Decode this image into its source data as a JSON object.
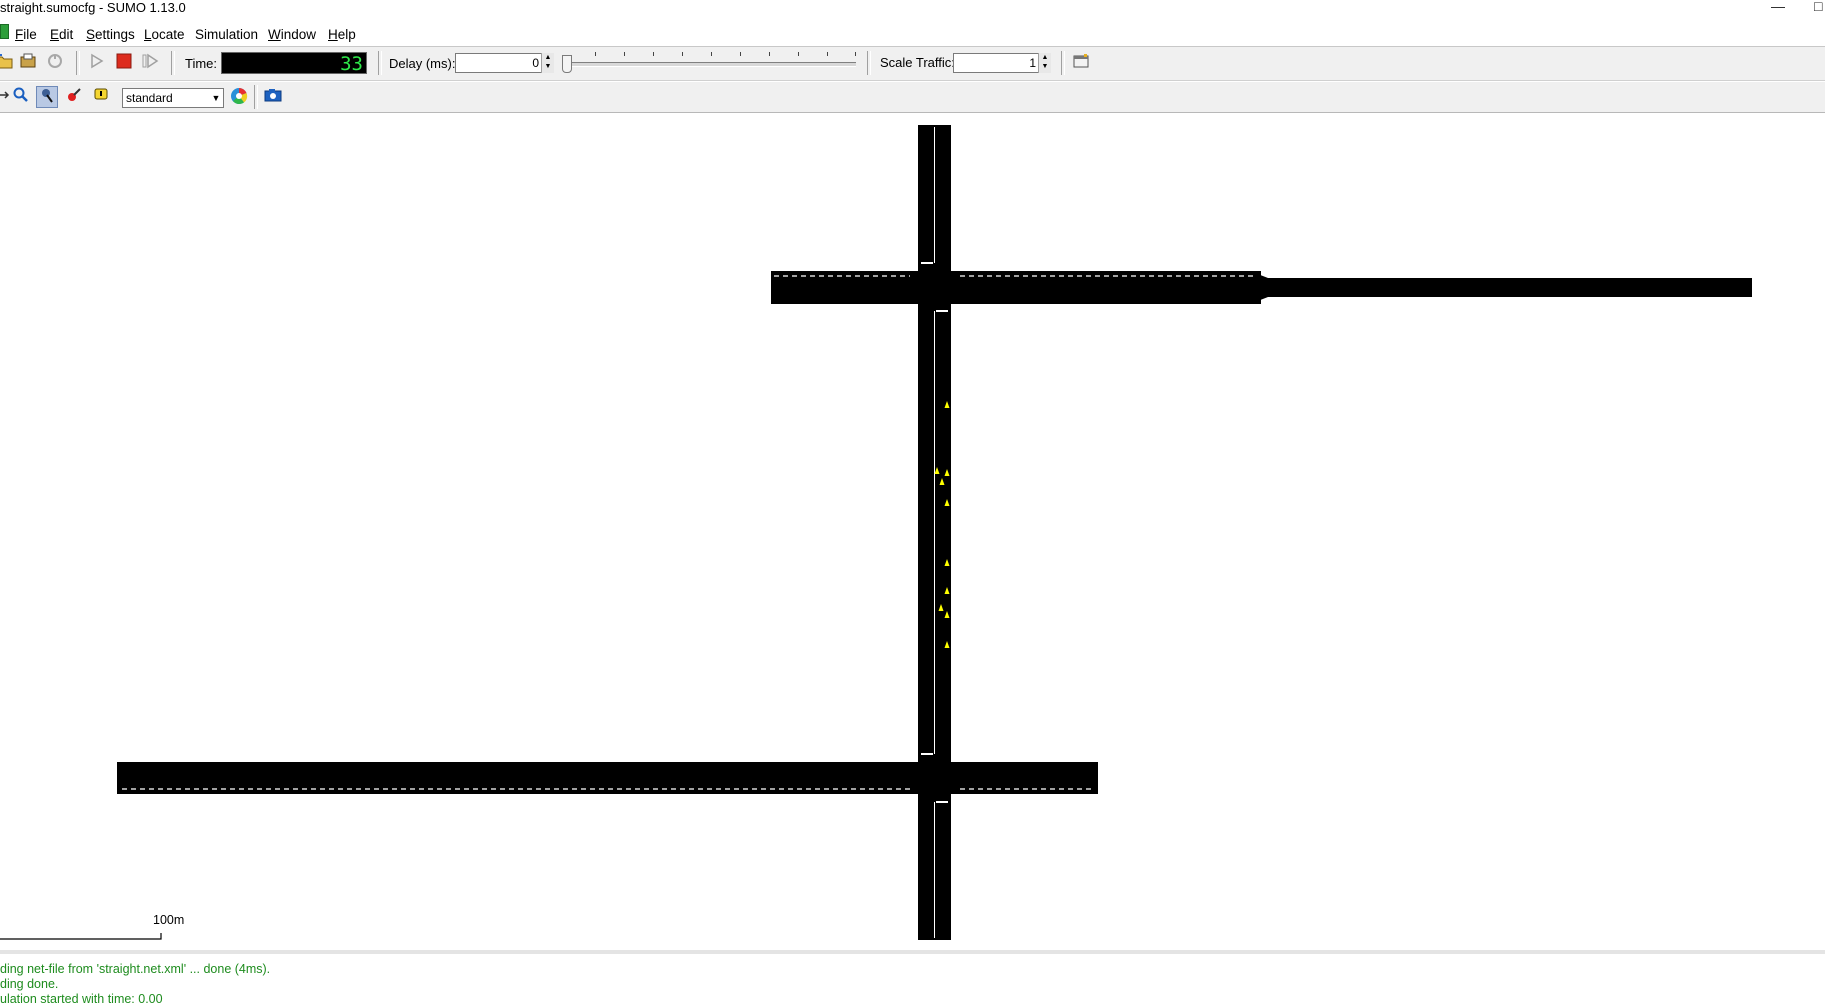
{
  "window": {
    "title": "straight.sumocfg - SUMO 1.13.0",
    "minimize_glyph": "—",
    "maximize_glyph": "□"
  },
  "menu": {
    "items": [
      {
        "label": "File",
        "accel": "F",
        "rest": "ile"
      },
      {
        "label": "Edit",
        "accel": "E",
        "rest": "dit"
      },
      {
        "label": "Settings",
        "accel": "S",
        "rest": "ettings"
      },
      {
        "label": "Locate",
        "accel": "L",
        "rest": "ocate"
      },
      {
        "label": "Simulation",
        "accel": "",
        "rest": "Simulation"
      },
      {
        "label": "Window",
        "accel": "W",
        "rest": "indow"
      },
      {
        "label": "Help",
        "accel": "H",
        "rest": "elp"
      }
    ]
  },
  "toolbar": {
    "time_label": "Time:",
    "time_value": "33",
    "delay_label": "Delay (ms):",
    "delay_value": "0",
    "scale_label": "Scale Traffic:",
    "scale_value": "1",
    "delay_slider_fraction": 0.0,
    "icons": {
      "open": "open-icon",
      "reload": "reload-icon",
      "save": "save-icon",
      "run": "run-icon",
      "stop": "stop-icon",
      "step": "step-icon",
      "breakpoint": "breakpoint-icon"
    }
  },
  "view_toolbar": {
    "scheme": "standard",
    "icons": {
      "recenter": "recenter-icon",
      "zoom": "zoom-icon",
      "locate": "locate-icon",
      "edit_view": "edit-view-icon",
      "edit_breakpoints": "edit-breakpoints-icon",
      "color_wheel": "color-wheel-icon",
      "screenshot": "screenshot-icon"
    }
  },
  "canvas": {
    "background": "#ffffff",
    "road_color": "#000000",
    "marking_color": "#ffffff",
    "vehicle_color": "#ffff00",
    "scale_label": "100m"
  },
  "messages": [
    "ding net-file from 'straight.net.xml' ... done (4ms).",
    "ding done.",
    "ulation started with time: 0.00"
  ],
  "colors": {
    "time_digits": "#2ee84a",
    "message_text": "#1e8c1e",
    "stop_button": "#dd2b1d"
  }
}
